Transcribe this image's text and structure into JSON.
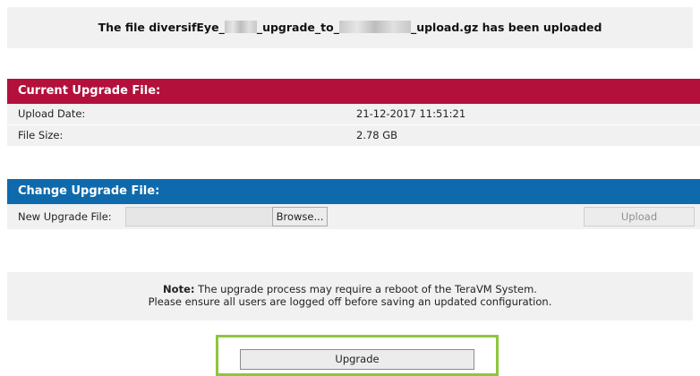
{
  "banner": {
    "prefix": "The file diversifEye_",
    "middle": "_upgrade_to_",
    "suffix": "_upload.gz has been uploaded"
  },
  "current": {
    "title": "Current Upgrade File:",
    "rows": [
      {
        "label": "Upload Date:",
        "value": "21-12-2017 11:51:21"
      },
      {
        "label": "File Size:",
        "value": "2.78 GB"
      }
    ]
  },
  "change": {
    "title": "Change Upgrade File:",
    "file_label": "New Upgrade File:",
    "file_value": "",
    "browse_label": "Browse...",
    "upload_label": "Upload"
  },
  "note": {
    "bold": "Note:",
    "line1": " The upgrade process may require a reboot of the TeraVM System.",
    "line2": "Please ensure all users are logged off before saving an updated configuration."
  },
  "upgrade_button": "Upgrade",
  "colors": {
    "current_header": "#b4103c",
    "change_header": "#0f6aad",
    "highlight": "#8cc63f"
  }
}
